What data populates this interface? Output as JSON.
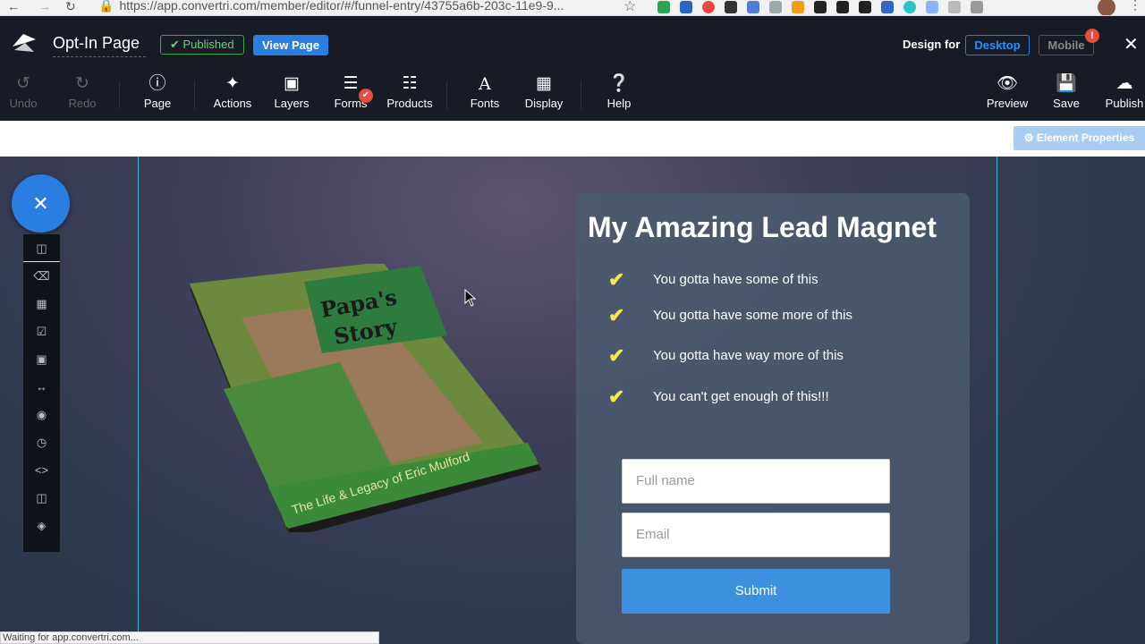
{
  "browser": {
    "url": "https://app.convertri.com/member/editor/#/funnel-entry/43755a6b-203c-11e9-9..."
  },
  "header": {
    "page_name": "Opt-In Page",
    "published_label": "Published",
    "view_page_label": "View Page",
    "design_for_label": "Design for",
    "desktop_label": "Desktop",
    "mobile_label": "Mobile",
    "mobile_badge": "!"
  },
  "toolbar": {
    "undo": "Undo",
    "redo": "Redo",
    "page": "Page",
    "actions": "Actions",
    "layers": "Layers",
    "forms": "Forms",
    "products": "Products",
    "fonts": "Fonts",
    "display": "Display",
    "help": "Help",
    "preview": "Preview",
    "save": "Save",
    "publish": "Publish"
  },
  "element_properties_label": "Element Properties",
  "book": {
    "title_line1": "Papa's",
    "title_line2": "Story",
    "subtitle": "The Life & Legacy of Eric Mulford"
  },
  "optin": {
    "title": "My Amazing Lead Magnet",
    "bullets": [
      "You gotta have some of this",
      "You gotta have some more of this",
      "You gotta have way more of this",
      "You can't get enough of this!!!"
    ],
    "fullname_placeholder": "Full name",
    "email_placeholder": "Email",
    "submit_label": "Submit"
  },
  "status_bar_text": "Waiting for app.convertri.com...",
  "colors": {
    "accent": "#2a7de1",
    "published_green": "#3fa64a",
    "check_yellow": "#f5e94a",
    "submit_blue": "#3d8fdf"
  }
}
